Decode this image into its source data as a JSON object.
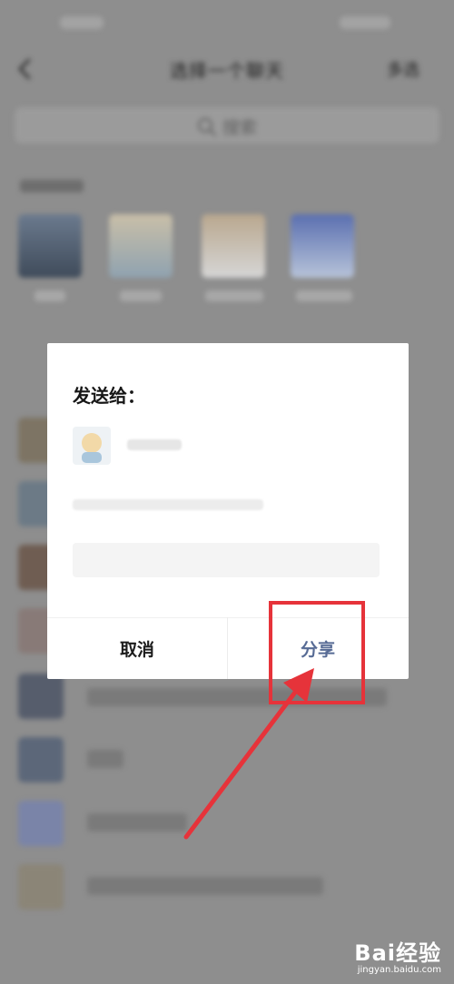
{
  "nav": {
    "title": "选择一个聊天",
    "multi_select": "多选"
  },
  "search": {
    "placeholder": "搜索"
  },
  "dialog": {
    "title": "发送给：",
    "cancel_label": "取消",
    "share_label": "分享"
  },
  "watermark": {
    "main": "Bai经验",
    "sub": "jingyan.baidu.com"
  },
  "colors": {
    "share_accent": "#576b95",
    "highlight_red": "#e6333a"
  }
}
